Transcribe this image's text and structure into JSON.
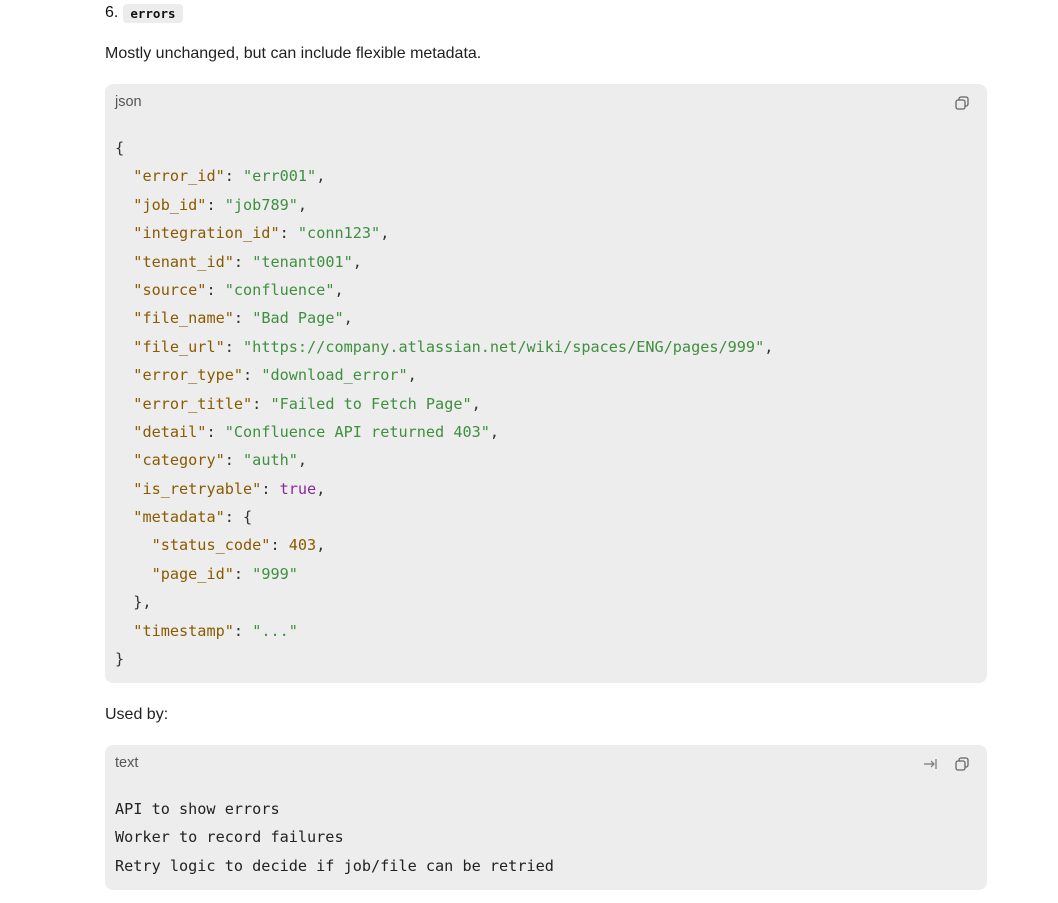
{
  "section": {
    "number": "6.",
    "name": "errors",
    "description": "Mostly unchanged, but can include flexible metadata."
  },
  "json_block": {
    "language": "json",
    "copy_tooltip": "Copy",
    "lines": [
      [
        {
          "t": "p",
          "v": "{"
        }
      ],
      [
        {
          "t": "p",
          "v": "  "
        },
        {
          "t": "k",
          "v": "\"error_id\""
        },
        {
          "t": "p",
          "v": ": "
        },
        {
          "t": "s",
          "v": "\"err001\""
        },
        {
          "t": "p",
          "v": ","
        }
      ],
      [
        {
          "t": "p",
          "v": "  "
        },
        {
          "t": "k",
          "v": "\"job_id\""
        },
        {
          "t": "p",
          "v": ": "
        },
        {
          "t": "s",
          "v": "\"job789\""
        },
        {
          "t": "p",
          "v": ","
        }
      ],
      [
        {
          "t": "p",
          "v": "  "
        },
        {
          "t": "k",
          "v": "\"integration_id\""
        },
        {
          "t": "p",
          "v": ": "
        },
        {
          "t": "s",
          "v": "\"conn123\""
        },
        {
          "t": "p",
          "v": ","
        }
      ],
      [
        {
          "t": "p",
          "v": "  "
        },
        {
          "t": "k",
          "v": "\"tenant_id\""
        },
        {
          "t": "p",
          "v": ": "
        },
        {
          "t": "s",
          "v": "\"tenant001\""
        },
        {
          "t": "p",
          "v": ","
        }
      ],
      [
        {
          "t": "p",
          "v": "  "
        },
        {
          "t": "k",
          "v": "\"source\""
        },
        {
          "t": "p",
          "v": ": "
        },
        {
          "t": "s",
          "v": "\"confluence\""
        },
        {
          "t": "p",
          "v": ","
        }
      ],
      [
        {
          "t": "p",
          "v": "  "
        },
        {
          "t": "k",
          "v": "\"file_name\""
        },
        {
          "t": "p",
          "v": ": "
        },
        {
          "t": "s",
          "v": "\"Bad Page\""
        },
        {
          "t": "p",
          "v": ","
        }
      ],
      [
        {
          "t": "p",
          "v": "  "
        },
        {
          "t": "k",
          "v": "\"file_url\""
        },
        {
          "t": "p",
          "v": ": "
        },
        {
          "t": "s",
          "v": "\"https://company.atlassian.net/wiki/spaces/ENG/pages/999\""
        },
        {
          "t": "p",
          "v": ","
        }
      ],
      [
        {
          "t": "p",
          "v": "  "
        },
        {
          "t": "k",
          "v": "\"error_type\""
        },
        {
          "t": "p",
          "v": ": "
        },
        {
          "t": "s",
          "v": "\"download_error\""
        },
        {
          "t": "p",
          "v": ","
        }
      ],
      [
        {
          "t": "p",
          "v": "  "
        },
        {
          "t": "k",
          "v": "\"error_title\""
        },
        {
          "t": "p",
          "v": ": "
        },
        {
          "t": "s",
          "v": "\"Failed to Fetch Page\""
        },
        {
          "t": "p",
          "v": ","
        }
      ],
      [
        {
          "t": "p",
          "v": "  "
        },
        {
          "t": "k",
          "v": "\"detail\""
        },
        {
          "t": "p",
          "v": ": "
        },
        {
          "t": "s",
          "v": "\"Confluence API returned 403\""
        },
        {
          "t": "p",
          "v": ","
        }
      ],
      [
        {
          "t": "p",
          "v": "  "
        },
        {
          "t": "k",
          "v": "\"category\""
        },
        {
          "t": "p",
          "v": ": "
        },
        {
          "t": "s",
          "v": "\"auth\""
        },
        {
          "t": "p",
          "v": ","
        }
      ],
      [
        {
          "t": "p",
          "v": "  "
        },
        {
          "t": "k",
          "v": "\"is_retryable\""
        },
        {
          "t": "p",
          "v": ": "
        },
        {
          "t": "b",
          "v": "true"
        },
        {
          "t": "p",
          "v": ","
        }
      ],
      [
        {
          "t": "p",
          "v": "  "
        },
        {
          "t": "k",
          "v": "\"metadata\""
        },
        {
          "t": "p",
          "v": ": {"
        }
      ],
      [
        {
          "t": "p",
          "v": "    "
        },
        {
          "t": "k",
          "v": "\"status_code\""
        },
        {
          "t": "p",
          "v": ": "
        },
        {
          "t": "n",
          "v": "403"
        },
        {
          "t": "p",
          "v": ","
        }
      ],
      [
        {
          "t": "p",
          "v": "    "
        },
        {
          "t": "k",
          "v": "\"page_id\""
        },
        {
          "t": "p",
          "v": ": "
        },
        {
          "t": "s",
          "v": "\"999\""
        }
      ],
      [
        {
          "t": "p",
          "v": "  },"
        }
      ],
      [
        {
          "t": "p",
          "v": "  "
        },
        {
          "t": "k",
          "v": "\"timestamp\""
        },
        {
          "t": "p",
          "v": ": "
        },
        {
          "t": "s",
          "v": "\"...\""
        }
      ],
      [
        {
          "t": "p",
          "v": "}"
        }
      ]
    ]
  },
  "used_by_label": "Used by:",
  "text_block": {
    "language": "text",
    "lines": [
      "API to show errors",
      "Worker to record failures",
      "Retry logic to decide if job/file can be retried"
    ]
  },
  "colors": {
    "code_bg": "#ededed",
    "key": "#8a5a00",
    "string": "#3f8f3f",
    "boolean": "#8a2a9a"
  }
}
